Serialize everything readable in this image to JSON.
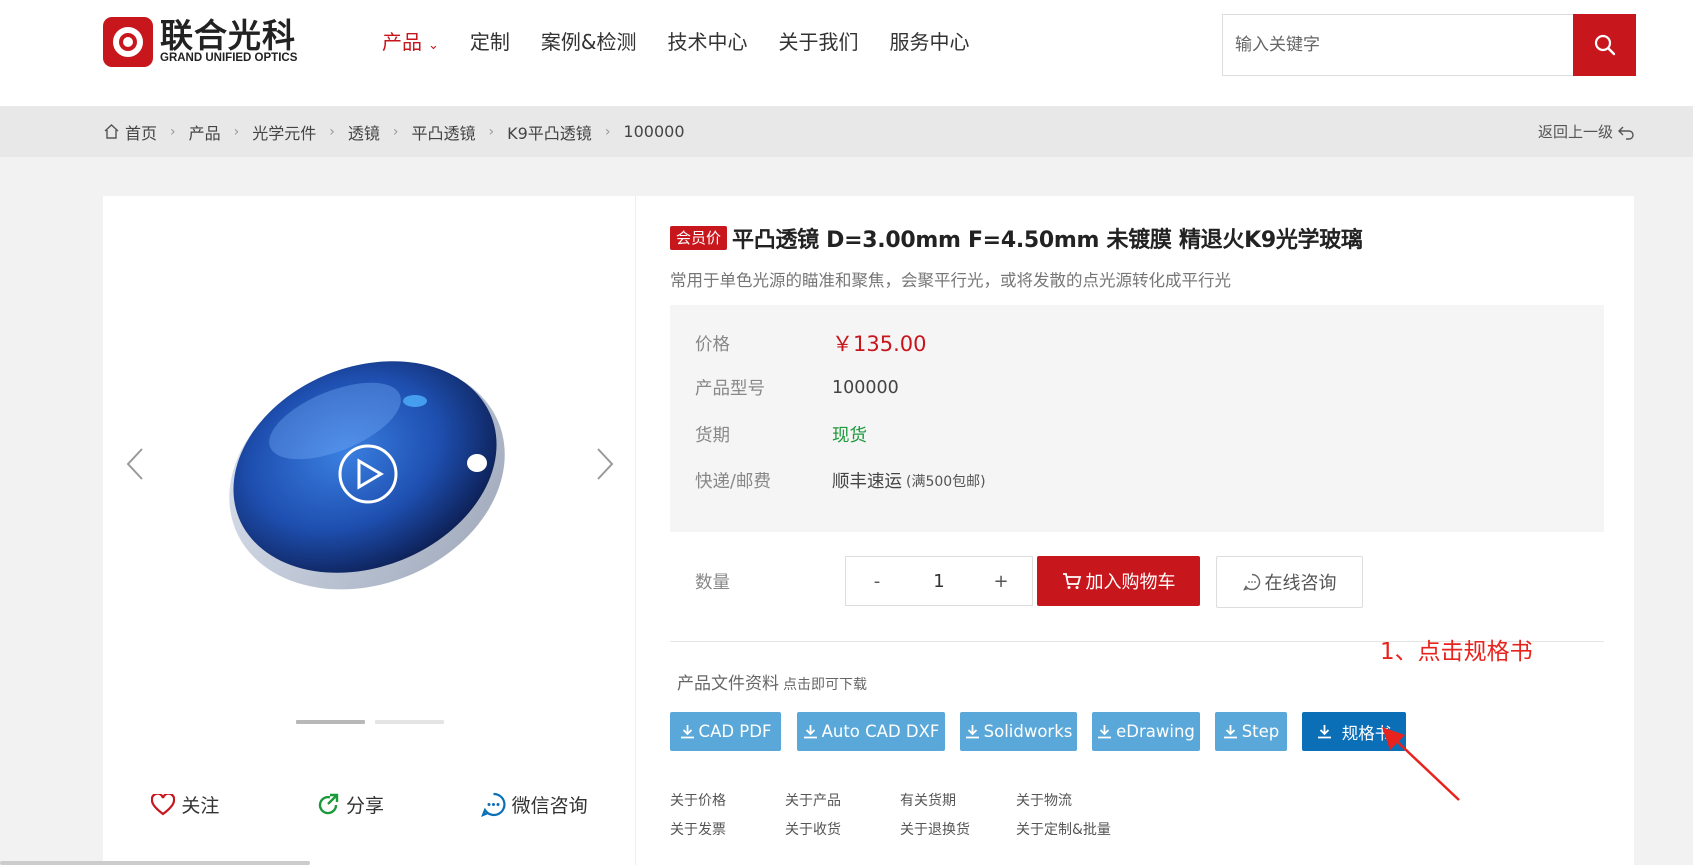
{
  "brand": {
    "name_cn": "联合光科",
    "name_en": "GRAND UNIFIED OPTICS"
  },
  "nav": {
    "items": [
      "产品",
      "定制",
      "案例&检测",
      "技术中心",
      "关于我们",
      "服务中心"
    ],
    "active": "产品"
  },
  "search": {
    "placeholder": "输入关键字"
  },
  "breadcrumb": {
    "items": [
      "首页",
      "产品",
      "光学元件",
      "透镜",
      "平凸透镜",
      "K9平凸透镜",
      "100000"
    ],
    "back_label": "返回上一级"
  },
  "product": {
    "badge": "会员价",
    "title": "平凸透镜 D=3.00mm F=4.50mm 未镀膜 精退火K9光学玻璃",
    "subtitle": "常用于单色光源的瞄准和聚焦，会聚平行光，或将发散的点光源转化成平行光",
    "price_label": "价格",
    "price": "￥135.00",
    "model_label": "产品型号",
    "model": "100000",
    "delivery_label": "货期",
    "delivery": "现货",
    "shipping_label": "快递/邮费",
    "shipping": "顺丰速运",
    "shipping_note": "(满500包邮)",
    "qty_label": "数量",
    "qty_minus": "-",
    "qty_value": "1",
    "qty_plus": "+",
    "add_cart": "加入购物车",
    "consult": "在线咨询"
  },
  "gallery": {
    "slides": 2,
    "current_slide": 1,
    "actions": [
      "关注",
      "分享",
      "微信咨询"
    ]
  },
  "docs": {
    "title": "产品文件资料",
    "hint": "点击即可下载",
    "buttons": [
      "CAD PDF",
      "Auto CAD DXF",
      "Solidworks",
      "eDrawing",
      "Step",
      "规格书"
    ],
    "annotation": "1、点击规格书"
  },
  "links": [
    "关于价格",
    "关于产品",
    "有关货期",
    "关于物流",
    "关于发票",
    "关于收货",
    "关于退换货",
    "关于定制&批量"
  ],
  "colors": {
    "brand_red": "#c8161d",
    "download_blue": "#5aa8d9",
    "spec_blue": "#0b6fb8",
    "stock_green": "#1a9a3a",
    "annotation_red": "#e8231d"
  }
}
